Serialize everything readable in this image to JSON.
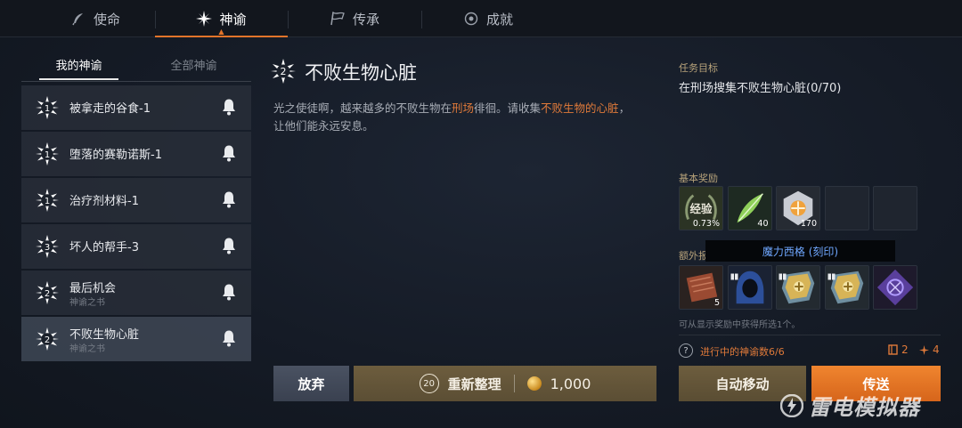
{
  "nav": {
    "tabs": [
      {
        "label": "使命",
        "icon": "feather-icon",
        "active": false
      },
      {
        "label": "神谕",
        "icon": "star-burst-icon",
        "active": true
      },
      {
        "label": "传承",
        "icon": "flag-icon",
        "active": false
      },
      {
        "label": "成就",
        "icon": "medal-icon",
        "active": false
      }
    ]
  },
  "left": {
    "subtabs": [
      "我的神谕",
      "全部神谕"
    ],
    "quests": [
      {
        "badge": "1",
        "title": "被拿走的谷食-1",
        "sub": ""
      },
      {
        "badge": "1",
        "title": "堕落的赛勒诺斯-1",
        "sub": ""
      },
      {
        "badge": "1",
        "title": "治疗剂材料-1",
        "sub": ""
      },
      {
        "badge": "3",
        "title": "坏人的帮手-3",
        "sub": ""
      },
      {
        "badge": "2",
        "title": "最后机会",
        "sub": "神谕之书"
      },
      {
        "badge": "2",
        "title": "不败生物心脏",
        "sub": "神谕之书"
      }
    ],
    "selected_index": 5
  },
  "detail": {
    "badge": "2",
    "title": "不败生物心脏",
    "desc_part1": "光之使徒啊，越来越多的不败生物在",
    "desc_hl1": "刑场",
    "desc_part2": "徘徊。请收集",
    "desc_hl2": "不败生物的心脏",
    "desc_part3": "，",
    "desc_line2": "让他们能永远安息。"
  },
  "right": {
    "objective_label": "任务目标",
    "objective_text": "在刑场搜集不败生物心脏(0/70)",
    "basic_reward_label": "基本奖励",
    "basic_rewards": [
      {
        "icon": "exp-laurel-icon",
        "count": "0.73%",
        "text": "经验"
      },
      {
        "icon": "green-feather-icon",
        "count": "40"
      },
      {
        "icon": "silver-crest-icon",
        "count": "170"
      },
      {
        "icon": "empty-slot",
        "count": ""
      },
      {
        "icon": "empty-slot",
        "count": ""
      }
    ],
    "extra_reward_label": "额外报",
    "tooltip": "魔力西格 (刻印)",
    "extra_rewards": [
      {
        "icon": "leather-scroll-icon",
        "count": "5",
        "book": false
      },
      {
        "icon": "blue-hood-icon",
        "count": "",
        "book": true
      },
      {
        "icon": "gold-shield-icon",
        "count": "",
        "book": true
      },
      {
        "icon": "gold-shield-icon",
        "count": "",
        "book": true
      },
      {
        "icon": "purple-rune-icon",
        "count": "",
        "book": false
      }
    ],
    "hint": "可从显示奖励中获得所选1个。",
    "progress_label": "进行中的神谕数6/6",
    "stat1": "2",
    "stat2": "4"
  },
  "buttons": {
    "abandon": "放弃",
    "reorg": "重新整理",
    "reorg_count": "20",
    "reorg_price": "1,000",
    "auto_move": "自动移动",
    "teleport": "传送"
  },
  "watermark": "雷电模拟器",
  "colors": {
    "accent": "#e2742a",
    "highlight": "#e07a3a",
    "tooltip_text": "#6fa7ff"
  }
}
